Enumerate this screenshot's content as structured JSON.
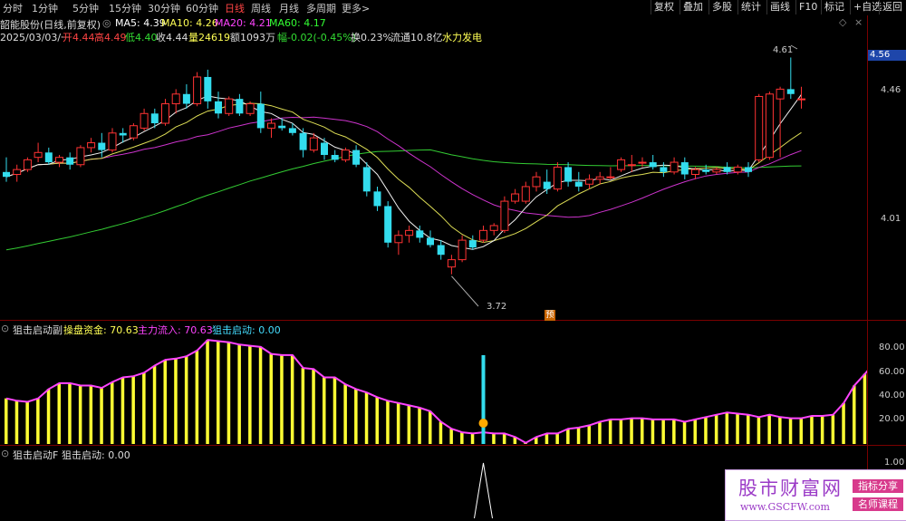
{
  "toolbar": {
    "timeframes": [
      "分时",
      "1分钟",
      "5分钟",
      "15分钟",
      "30分钟",
      "60分钟",
      "日线",
      "周线",
      "月线",
      "多周期",
      "更多>"
    ],
    "active": "日线",
    "right_buttons": [
      "复权",
      "叠加",
      "多股",
      "统计",
      "画线",
      "F10",
      "标记",
      "+自选",
      "返回"
    ]
  },
  "header": {
    "stock_title": "韶能股份(日线,前复权)",
    "ma_labels": [
      {
        "text": "MA5: 4.39",
        "color": "#ffffff"
      },
      {
        "text": "MA10: 4.26",
        "color": "#ffff55"
      },
      {
        "text": "MA20: 4.21",
        "color": "#ff44ff"
      },
      {
        "text": "MA60: 4.17",
        "color": "#33ff33"
      }
    ],
    "info_date": "2025/03/03/一",
    "info_open": "开4.44",
    "info_high": "高4.49",
    "info_low": "低4.40",
    "info_close": "收4.44",
    "info_volume": "量24619",
    "info_amount": "额1093万",
    "info_change": "幅-0.02(-0.45%)",
    "info_turnover": "换0.23%",
    "info_float": "流通10.8亿",
    "info_concept": "水力发电"
  },
  "price_axis": {
    "current_tag": "4.56",
    "ticks": [
      "4.46",
      "4.01"
    ]
  },
  "annotations": {
    "high_marker": "4.61",
    "low_marker": "3.72",
    "preview_badge": "预"
  },
  "sub1": {
    "name": "狙击启动副",
    "label1": "操盘资金: 70.63",
    "label2": "主力流入: 70.63",
    "label3": "狙击启动: 0.00",
    "ticks": [
      "80.00",
      "60.00",
      "40.00",
      "20.00"
    ]
  },
  "sub2": {
    "name": "狙击启动F",
    "label1": "狙击启动: 0.00",
    "ticks": [
      "1.00"
    ]
  },
  "watermark": {
    "title": "股市财富网",
    "url": "www.GSCFW.com",
    "tag1": "指标分享",
    "tag2": "名师课程"
  },
  "chart_data": {
    "type": "candlestick",
    "price_range": [
      3.6,
      4.66
    ],
    "candles": [
      {
        "o": 4.14,
        "h": 4.2,
        "l": 4.1,
        "c": 4.12
      },
      {
        "o": 4.13,
        "h": 4.17,
        "l": 4.1,
        "c": 4.15
      },
      {
        "o": 4.15,
        "h": 4.2,
        "l": 4.14,
        "c": 4.19
      },
      {
        "o": 4.2,
        "h": 4.26,
        "l": 4.18,
        "c": 4.22
      },
      {
        "o": 4.22,
        "h": 4.24,
        "l": 4.17,
        "c": 4.18
      },
      {
        "o": 4.18,
        "h": 4.21,
        "l": 4.16,
        "c": 4.2
      },
      {
        "o": 4.2,
        "h": 4.22,
        "l": 4.15,
        "c": 4.17
      },
      {
        "o": 4.17,
        "h": 4.25,
        "l": 4.16,
        "c": 4.24
      },
      {
        "o": 4.24,
        "h": 4.28,
        "l": 4.22,
        "c": 4.26
      },
      {
        "o": 4.26,
        "h": 4.3,
        "l": 4.2,
        "c": 4.23
      },
      {
        "o": 4.23,
        "h": 4.32,
        "l": 4.22,
        "c": 4.3
      },
      {
        "o": 4.3,
        "h": 4.32,
        "l": 4.26,
        "c": 4.29
      },
      {
        "o": 4.28,
        "h": 4.34,
        "l": 4.27,
        "c": 4.33
      },
      {
        "o": 4.32,
        "h": 4.4,
        "l": 4.31,
        "c": 4.38
      },
      {
        "o": 4.38,
        "h": 4.4,
        "l": 4.32,
        "c": 4.34
      },
      {
        "o": 4.34,
        "h": 4.44,
        "l": 4.33,
        "c": 4.42
      },
      {
        "o": 4.42,
        "h": 4.48,
        "l": 4.38,
        "c": 4.46
      },
      {
        "o": 4.46,
        "h": 4.5,
        "l": 4.4,
        "c": 4.42
      },
      {
        "o": 4.42,
        "h": 4.55,
        "l": 4.41,
        "c": 4.53
      },
      {
        "o": 4.53,
        "h": 4.56,
        "l": 4.4,
        "c": 4.43
      },
      {
        "o": 4.43,
        "h": 4.47,
        "l": 4.36,
        "c": 4.38
      },
      {
        "o": 4.38,
        "h": 4.45,
        "l": 4.37,
        "c": 4.44
      },
      {
        "o": 4.44,
        "h": 4.46,
        "l": 4.37,
        "c": 4.38
      },
      {
        "o": 4.38,
        "h": 4.43,
        "l": 4.37,
        "c": 4.42
      },
      {
        "o": 4.42,
        "h": 4.47,
        "l": 4.3,
        "c": 4.32
      },
      {
        "o": 4.32,
        "h": 4.36,
        "l": 4.28,
        "c": 4.34
      },
      {
        "o": 4.33,
        "h": 4.36,
        "l": 4.31,
        "c": 4.32
      },
      {
        "o": 4.32,
        "h": 4.34,
        "l": 4.29,
        "c": 4.3
      },
      {
        "o": 4.3,
        "h": 4.32,
        "l": 4.2,
        "c": 4.23
      },
      {
        "o": 4.23,
        "h": 4.3,
        "l": 4.22,
        "c": 4.28
      },
      {
        "o": 4.26,
        "h": 4.28,
        "l": 4.19,
        "c": 4.21
      },
      {
        "o": 4.21,
        "h": 4.23,
        "l": 4.18,
        "c": 4.19
      },
      {
        "o": 4.19,
        "h": 4.24,
        "l": 4.18,
        "c": 4.23
      },
      {
        "o": 4.23,
        "h": 4.25,
        "l": 4.16,
        "c": 4.17
      },
      {
        "o": 4.16,
        "h": 4.18,
        "l": 4.04,
        "c": 4.06
      },
      {
        "o": 4.06,
        "h": 4.08,
        "l": 3.98,
        "c": 4.0
      },
      {
        "o": 4.0,
        "h": 4.02,
        "l": 3.83,
        "c": 3.85
      },
      {
        "o": 3.85,
        "h": 3.9,
        "l": 3.8,
        "c": 3.88
      },
      {
        "o": 3.88,
        "h": 3.92,
        "l": 3.85,
        "c": 3.9
      },
      {
        "o": 3.9,
        "h": 3.92,
        "l": 3.85,
        "c": 3.87
      },
      {
        "o": 3.87,
        "h": 3.9,
        "l": 3.83,
        "c": 3.84
      },
      {
        "o": 3.84,
        "h": 3.86,
        "l": 3.78,
        "c": 3.8
      },
      {
        "o": 3.75,
        "h": 3.8,
        "l": 3.72,
        "c": 3.78
      },
      {
        "o": 3.78,
        "h": 3.88,
        "l": 3.77,
        "c": 3.86
      },
      {
        "o": 3.86,
        "h": 3.88,
        "l": 3.82,
        "c": 3.83
      },
      {
        "o": 3.86,
        "h": 3.92,
        "l": 3.85,
        "c": 3.9
      },
      {
        "o": 3.9,
        "h": 3.93,
        "l": 3.88,
        "c": 3.92
      },
      {
        "o": 3.9,
        "h": 4.04,
        "l": 3.89,
        "c": 4.02
      },
      {
        "o": 4.02,
        "h": 4.07,
        "l": 4.01,
        "c": 4.05
      },
      {
        "o": 4.02,
        "h": 4.1,
        "l": 4.01,
        "c": 4.08
      },
      {
        "o": 4.08,
        "h": 4.14,
        "l": 4.06,
        "c": 4.12
      },
      {
        "o": 4.1,
        "h": 4.15,
        "l": 4.05,
        "c": 4.07
      },
      {
        "o": 4.07,
        "h": 4.18,
        "l": 4.06,
        "c": 4.16
      },
      {
        "o": 4.16,
        "h": 4.18,
        "l": 4.08,
        "c": 4.1
      },
      {
        "o": 4.1,
        "h": 4.14,
        "l": 4.06,
        "c": 4.08
      },
      {
        "o": 4.09,
        "h": 4.13,
        "l": 4.07,
        "c": 4.11
      },
      {
        "o": 4.11,
        "h": 4.14,
        "l": 4.09,
        "c": 4.12
      },
      {
        "o": 4.12,
        "h": 4.16,
        "l": 4.11,
        "c": 4.12
      },
      {
        "o": 4.15,
        "h": 4.2,
        "l": 4.14,
        "c": 4.19
      },
      {
        "o": 4.17,
        "h": 4.21,
        "l": 4.14,
        "c": 4.17
      },
      {
        "o": 4.18,
        "h": 4.2,
        "l": 4.16,
        "c": 4.18
      },
      {
        "o": 4.18,
        "h": 4.21,
        "l": 4.15,
        "c": 4.16
      },
      {
        "o": 4.16,
        "h": 4.18,
        "l": 4.12,
        "c": 4.14
      },
      {
        "o": 4.14,
        "h": 4.2,
        "l": 4.13,
        "c": 4.18
      },
      {
        "o": 4.18,
        "h": 4.2,
        "l": 4.11,
        "c": 4.13
      },
      {
        "o": 4.13,
        "h": 4.16,
        "l": 4.11,
        "c": 4.15
      },
      {
        "o": 4.15,
        "h": 4.17,
        "l": 4.13,
        "c": 4.14
      },
      {
        "o": 4.14,
        "h": 4.16,
        "l": 4.13,
        "c": 4.15
      },
      {
        "o": 4.16,
        "h": 4.18,
        "l": 4.13,
        "c": 4.14
      },
      {
        "o": 4.14,
        "h": 4.17,
        "l": 4.13,
        "c": 4.16
      },
      {
        "o": 4.16,
        "h": 4.18,
        "l": 4.12,
        "c": 4.14
      },
      {
        "o": 4.19,
        "h": 4.46,
        "l": 4.18,
        "c": 4.45
      },
      {
        "o": 4.2,
        "h": 4.47,
        "l": 4.19,
        "c": 4.46
      },
      {
        "o": 4.44,
        "h": 4.49,
        "l": 4.2,
        "c": 4.48
      },
      {
        "o": 4.48,
        "h": 4.61,
        "l": 4.44,
        "c": 4.46
      },
      {
        "o": 4.44,
        "h": 4.49,
        "l": 4.4,
        "c": 4.44
      }
    ],
    "sub1_values": [
      39,
      37,
      36,
      39,
      47,
      52,
      52,
      50,
      50,
      48,
      53,
      57,
      58,
      61,
      67,
      72,
      73,
      75,
      80,
      89,
      88,
      87,
      85,
      84,
      83,
      77,
      76,
      76,
      65,
      64,
      57,
      57,
      51,
      47,
      44,
      40,
      37,
      35,
      33,
      31,
      28,
      19,
      13,
      10,
      9,
      10,
      9,
      9,
      6,
      1,
      6,
      9,
      9,
      13,
      14,
      16,
      19,
      21,
      21,
      22,
      22,
      21,
      21,
      21,
      19,
      21,
      23,
      25,
      27,
      26,
      25,
      23,
      25,
      23,
      22,
      22,
      24,
      24,
      25,
      35,
      50,
      60,
      70.63,
      70.63
    ],
    "sub1_signal": 76,
    "sub2_signal_index": 45
  }
}
